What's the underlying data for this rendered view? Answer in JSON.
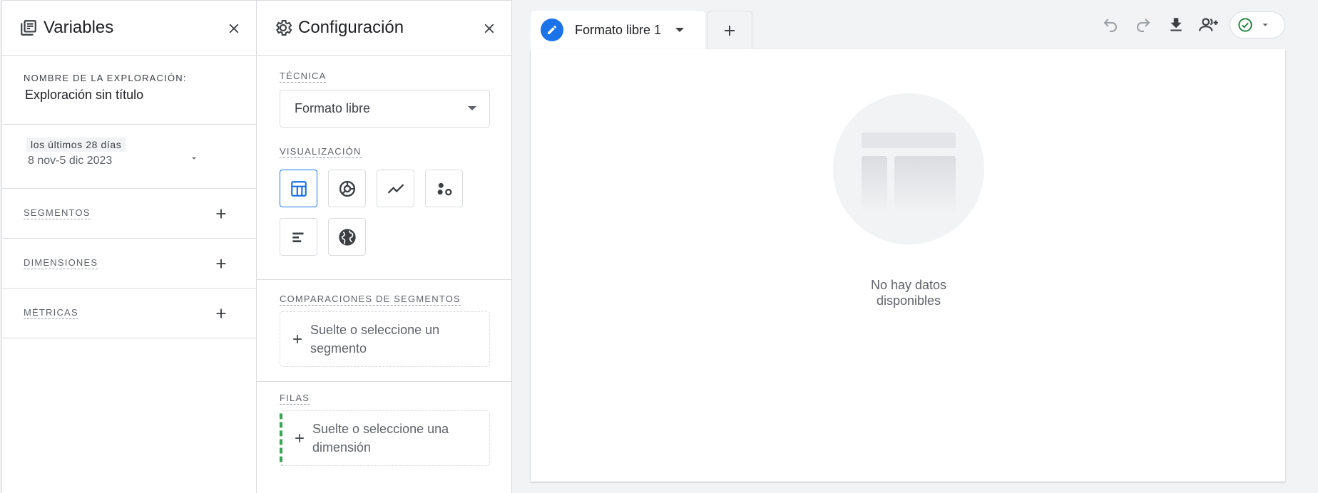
{
  "variables": {
    "title": "Variables",
    "exploration_name_label": "NOMBRE DE LA EXPLORACIÓN:",
    "exploration_name": "Exploración sin título",
    "date_chip": "los últimos 28 días",
    "date_range": "8 nov-5 dic 2023",
    "segments_label": "SEGMENTOS",
    "dimensions_label": "DIMENSIONES",
    "metrics_label": "MÉTRICAS"
  },
  "config": {
    "title": "Configuración",
    "technique_label": "TÉCNICA",
    "technique_value": "Formato libre",
    "visualization_label": "VISUALIZACIÓN",
    "visualizations": [
      {
        "name": "table",
        "icon": "table-icon",
        "active": true
      },
      {
        "name": "donut",
        "icon": "donut-chart-icon",
        "active": false
      },
      {
        "name": "line",
        "icon": "line-chart-icon",
        "active": false
      },
      {
        "name": "scatter",
        "icon": "scatter-plot-icon",
        "active": false
      },
      {
        "name": "bar",
        "icon": "bar-chart-icon",
        "active": false
      },
      {
        "name": "geo",
        "icon": "globe-icon",
        "active": false
      }
    ],
    "segment_comparisons_label": "COMPARACIONES DE SEGMENTOS",
    "segment_drop_text": "Suelte o seleccione un segmento",
    "rows_label": "FILAS",
    "rows_drop_text": "Suelte o seleccione una dimensión"
  },
  "canvas": {
    "tab_label": "Formato libre 1",
    "empty_text": "No hay datos\ndisponibles"
  },
  "colors": {
    "accent": "#1a73e8",
    "success": "#188038",
    "rows_indicator": "#34a853"
  }
}
